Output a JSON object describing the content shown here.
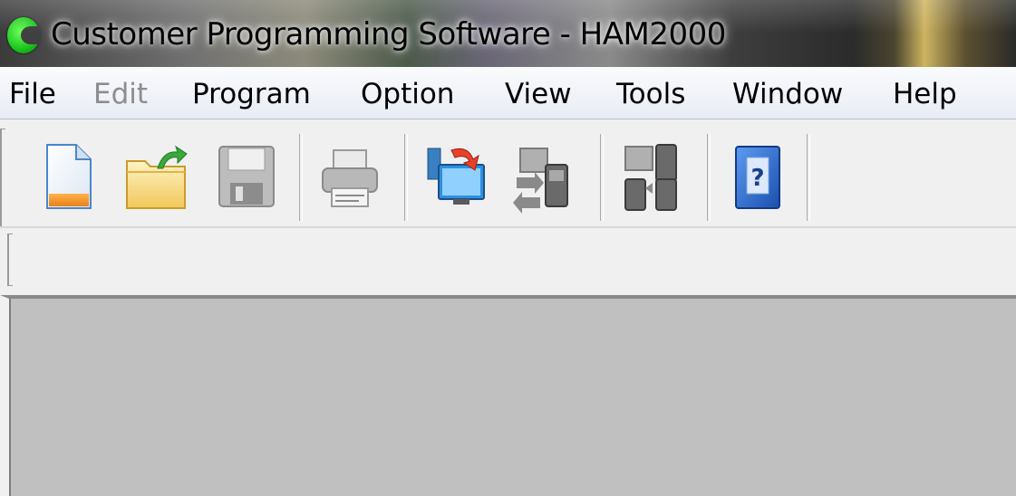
{
  "window": {
    "title": "Customer Programming Software - HAM2000",
    "app_icon": "green-c-logo-icon"
  },
  "menubar": {
    "items": [
      {
        "label": "File",
        "enabled": true
      },
      {
        "label": "Edit",
        "enabled": false
      },
      {
        "label": "Program",
        "enabled": true
      },
      {
        "label": "Option",
        "enabled": true
      },
      {
        "label": "View",
        "enabled": true
      },
      {
        "label": "Tools",
        "enabled": true
      },
      {
        "label": "Window",
        "enabled": true
      },
      {
        "label": "Help",
        "enabled": true
      }
    ]
  },
  "toolbar": {
    "buttons": [
      {
        "icon": "new-document-icon",
        "enabled": true
      },
      {
        "icon": "open-folder-icon",
        "enabled": true
      },
      {
        "icon": "save-disk-icon",
        "enabled": false
      },
      {
        "icon": "print-icon",
        "enabled": false
      },
      {
        "icon": "read-from-radio-icon",
        "enabled": true
      },
      {
        "icon": "write-to-radio-icon",
        "enabled": false
      },
      {
        "icon": "clone-radio-icon",
        "enabled": false
      },
      {
        "icon": "help-book-icon",
        "enabled": true
      }
    ]
  },
  "colors": {
    "menubar_bg": "#e8ecf4",
    "workspace_bg": "#c0c0c0",
    "toolbar_bg": "#f0f0f0",
    "disabled_text": "#8d8d8d"
  }
}
